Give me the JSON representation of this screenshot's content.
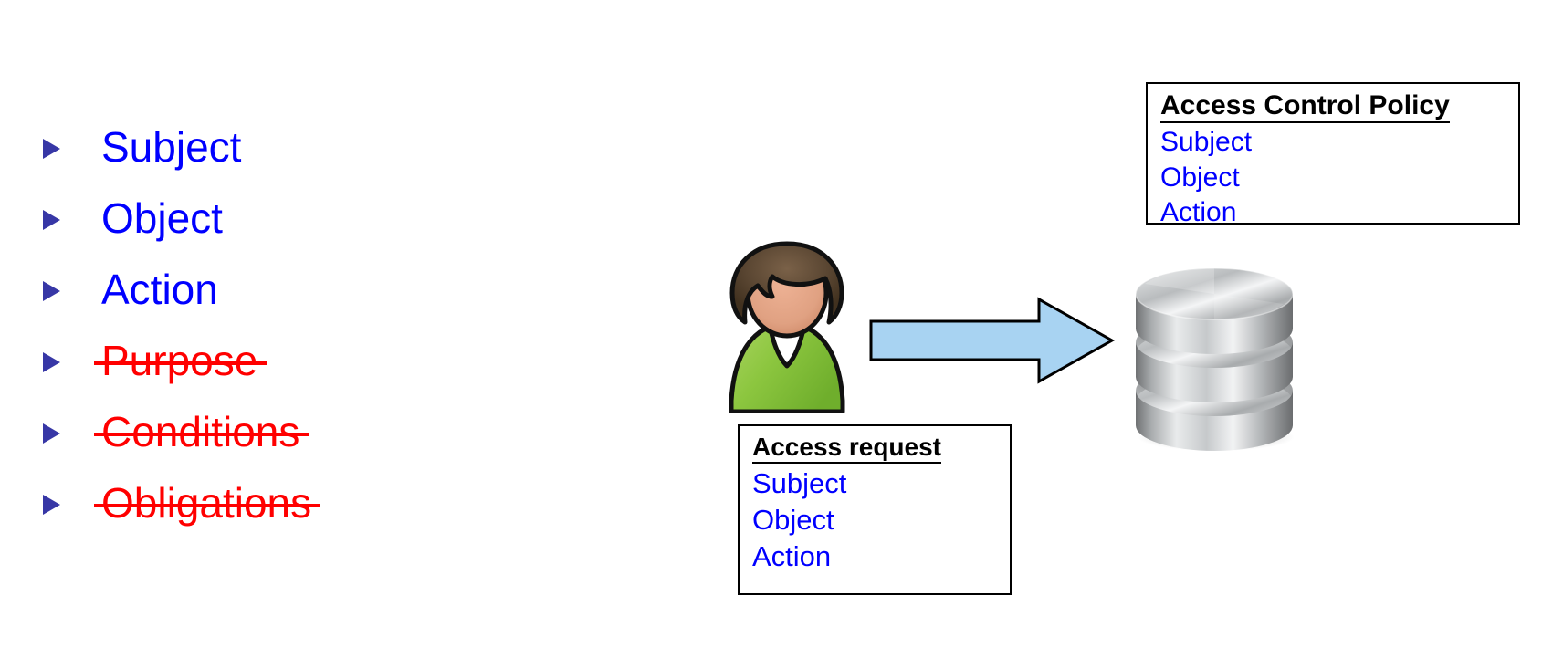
{
  "slide": {
    "bullets": [
      {
        "label": "Subject",
        "state": "active"
      },
      {
        "label": "Object",
        "state": "active"
      },
      {
        "label": "Action",
        "state": "active"
      },
      {
        "label": "Purpose",
        "state": "struck"
      },
      {
        "label": "Conditions",
        "state": "struck"
      },
      {
        "label": "Obligations",
        "state": "struck"
      }
    ],
    "access_control_policy": {
      "title": "Access Control Policy",
      "lines": [
        "Subject",
        "Object",
        "Action"
      ]
    },
    "access_request": {
      "title": "Access request",
      "lines": [
        "Subject",
        "Object",
        "Action"
      ]
    },
    "icons": {
      "user": "user-icon",
      "arrow": "right-arrow-icon",
      "database": "database-cylinder-icon",
      "bullet": "triangle-bullet-icon"
    },
    "colors": {
      "active_text": "#0000FF",
      "struck_text": "#FF0000",
      "bullet_marker": "#3737A6",
      "arrow_fill": "#A8D3F2",
      "arrow_stroke": "#000000",
      "box_border": "#000000",
      "title_text": "#000000",
      "user_hair": "#5A4632",
      "user_face": "#E0A182",
      "user_shirt": "#8CC63F",
      "database_metal": "#C9CBCC",
      "background": "#FFFFFF"
    }
  }
}
